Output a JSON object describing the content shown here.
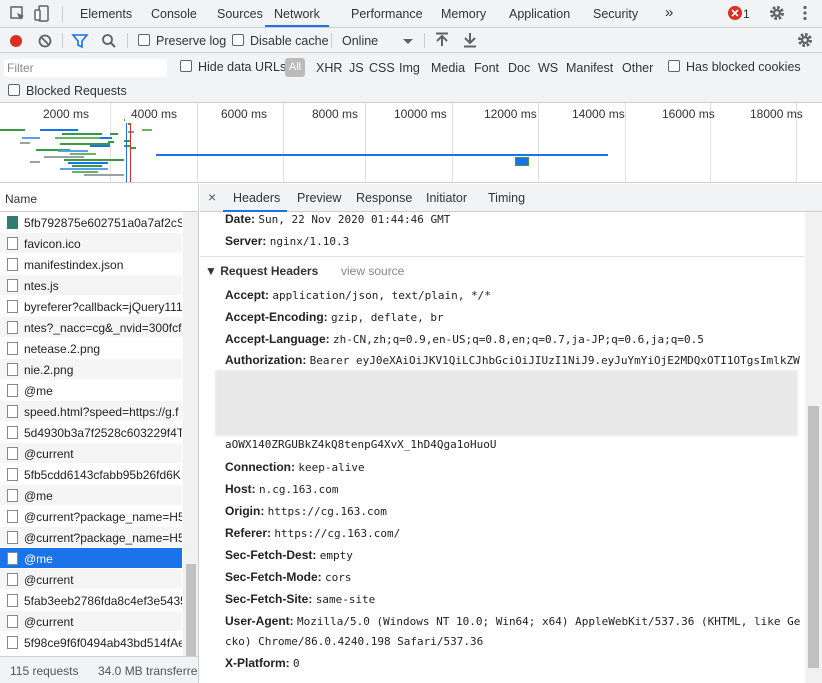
{
  "tabs": [
    {
      "label": "Elements"
    },
    {
      "label": "Console"
    },
    {
      "label": "Sources"
    },
    {
      "label": "Network"
    },
    {
      "label": "Performance"
    },
    {
      "label": "Memory"
    },
    {
      "label": "Application"
    },
    {
      "label": "Security"
    }
  ],
  "active_tab": "Network",
  "more_tabs": "»",
  "error_count": "1",
  "toolbar": {
    "preserve_log": "Preserve log",
    "disable_cache": "Disable cache",
    "throttle": "Online"
  },
  "filter": {
    "placeholder": "Filter",
    "hide_data_urls": "Hide data URLs",
    "types": [
      "All",
      "XHR",
      "JS",
      "CSS",
      "Img",
      "Media",
      "Font",
      "Doc",
      "WS",
      "Manifest",
      "Other"
    ],
    "has_blocked_cookies": "Has blocked cookies",
    "blocked_requests": "Blocked Requests"
  },
  "overview": {
    "ticks": [
      "2000 ms",
      "4000 ms",
      "6000 ms",
      "8000 ms",
      "10000 ms",
      "12000 ms",
      "14000 ms",
      "16000 ms",
      "18000 ms"
    ]
  },
  "request_list": {
    "header": "Name",
    "items": [
      {
        "name": "5fb792875e602751a0a7af2cSl",
        "type": "img"
      },
      {
        "name": "favicon.ico",
        "type": "doc"
      },
      {
        "name": "manifestindex.json",
        "type": "doc"
      },
      {
        "name": "ntes.js",
        "type": "doc"
      },
      {
        "name": "byreferer?callback=jQuery111",
        "type": "doc"
      },
      {
        "name": "ntes?_nacc=cg&_nvid=300fcf..",
        "type": "doc"
      },
      {
        "name": "netease.2.png",
        "type": "doc"
      },
      {
        "name": "nie.2.png",
        "type": "doc"
      },
      {
        "name": "@me",
        "type": "doc"
      },
      {
        "name": "speed.html?speed=https://g.f",
        "type": "doc"
      },
      {
        "name": "5d4930b3a7f2528c603229f4T",
        "type": "doc"
      },
      {
        "name": "@current",
        "type": "doc"
      },
      {
        "name": "5fb5cdd6143cfabb95b26fd6K",
        "type": "doc"
      },
      {
        "name": "@me",
        "type": "doc"
      },
      {
        "name": "@current?package_name=H5",
        "type": "doc"
      },
      {
        "name": "@current?package_name=H5",
        "type": "doc"
      },
      {
        "name": "@me",
        "type": "doc",
        "selected": true
      },
      {
        "name": "@current",
        "type": "doc"
      },
      {
        "name": "5fab3eeb2786fda8c4ef3e5435",
        "type": "doc"
      },
      {
        "name": "@current",
        "type": "doc"
      },
      {
        "name": "5f98ce9f6f0494ab43bd514fAe",
        "type": "doc"
      }
    ],
    "status_requests": "115 requests",
    "status_transferred": "34.0 MB transferre"
  },
  "detail": {
    "close": "×",
    "tabs": [
      "Headers",
      "Preview",
      "Response",
      "Initiator",
      "Timing"
    ],
    "active_tab": "Headers",
    "response_headers": [
      {
        "key": "Date:",
        "value": "Sun, 22 Nov 2020 01:44:46 GMT"
      },
      {
        "key": "Server:",
        "value": "nginx/1.10.3"
      }
    ],
    "request_headers_title": "▼ Request Headers",
    "view_source": "view source",
    "request_headers": [
      {
        "key": "Accept:",
        "value": "application/json, text/plain, */*"
      },
      {
        "key": "Accept-Encoding:",
        "value": "gzip, deflate, br"
      },
      {
        "key": "Accept-Language:",
        "value": "zh-CN,zh;q=0.9,en-US;q=0.8,en;q=0.7,ja-JP;q=0.6,ja;q=0.5"
      },
      {
        "key": "Authorization:",
        "value": "Bearer eyJ0eXAiOiJKV1QiLCJhbGciOiJIUzI1NiJ9.eyJuYmYiOjE2MDQxOTI1OTgsImlkZW"
      }
    ],
    "auth_tail": "aOWX140ZRGUBkZ4kQ8tenpG4XvX_1hD4Qga1oHuoU",
    "request_headers_2": [
      {
        "key": "Connection:",
        "value": "keep-alive"
      },
      {
        "key": "Host:",
        "value": "n.cg.163.com"
      },
      {
        "key": "Origin:",
        "value": "https://cg.163.com"
      },
      {
        "key": "Referer:",
        "value": "https://cg.163.com/"
      },
      {
        "key": "Sec-Fetch-Dest:",
        "value": "empty"
      },
      {
        "key": "Sec-Fetch-Mode:",
        "value": "cors"
      },
      {
        "key": "Sec-Fetch-Site:",
        "value": "same-site"
      },
      {
        "key": "User-Agent:",
        "value": "Mozilla/5.0 (Windows NT 10.0; Win64; x64) AppleWebKit/537.36 (KHTML, like Ge"
      }
    ],
    "user_agent_cont": "cko) Chrome/86.0.4240.198 Safari/537.36",
    "x_platform": {
      "key": "X-Platform:",
      "value": "0"
    }
  },
  "colors": {
    "accent": "#1a73e8",
    "record": "#d93025",
    "error": "#d93025",
    "selected_row": "#1a73e8"
  }
}
